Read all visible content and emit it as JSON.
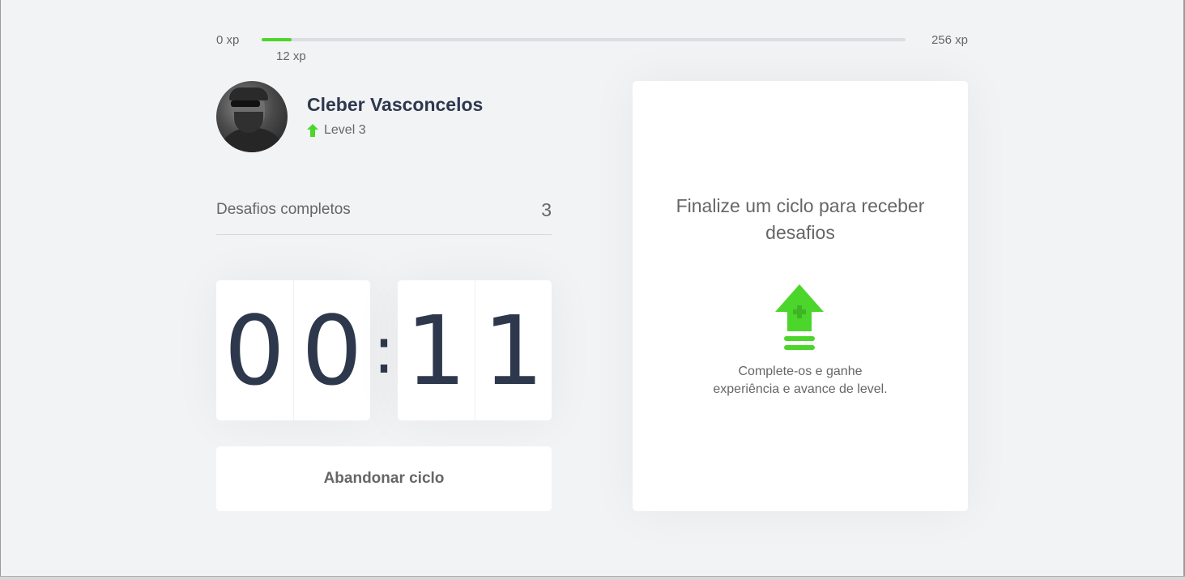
{
  "xp": {
    "min_label": "0 xp",
    "max_label": "256 xp",
    "current_label": "12 xp",
    "current": 12,
    "max": 256,
    "accent_color": "#4cd62b"
  },
  "profile": {
    "name": "Cleber Vasconcelos",
    "level_label": "Level 3"
  },
  "completed": {
    "label": "Desafios completos",
    "count": "3"
  },
  "countdown": {
    "minute_left": "0",
    "minute_right": "0",
    "separator": ":",
    "second_left": "1",
    "second_right": "1"
  },
  "actions": {
    "abandon_label": "Abandonar ciclo"
  },
  "challenge": {
    "title": "Finalize um ciclo para receber desafios",
    "line1": "Complete-os e ganhe",
    "line2": "experiência e avance de level.",
    "icon": "level-up-icon"
  },
  "colors": {
    "background": "#f2f3f5",
    "title": "#2e384d",
    "text": "#666666",
    "green": "#4cd62b"
  }
}
